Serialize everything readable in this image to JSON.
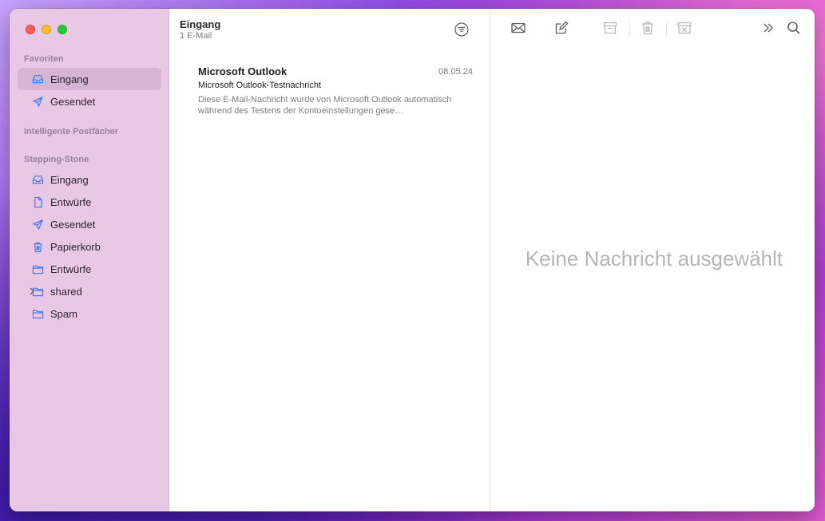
{
  "sidebar": {
    "favorites_title": "Favoriten",
    "favorites": [
      {
        "label": "Eingang",
        "icon": "inbox-icon",
        "selected": true
      },
      {
        "label": "Gesendet",
        "icon": "paperplane-icon"
      }
    ],
    "smart_title": "Intelligente Postfächer",
    "account_title": "Stepping-Stone",
    "account_items": [
      {
        "label": "Eingang",
        "icon": "inbox-icon"
      },
      {
        "label": "Entwürfe",
        "icon": "document-icon"
      },
      {
        "label": "Gesendet",
        "icon": "paperplane-icon"
      },
      {
        "label": "Papierkorb",
        "icon": "trash-icon"
      },
      {
        "label": "Entwürfe",
        "icon": "folder-icon"
      },
      {
        "label": "shared",
        "icon": "folder-icon",
        "collapsed": true
      },
      {
        "label": "Spam",
        "icon": "folder-icon"
      }
    ]
  },
  "list": {
    "title": "Eingang",
    "count": "1 E-Mail",
    "messages": [
      {
        "sender": "Microsoft Outlook",
        "date": "08.05.24",
        "subject": "Microsoft Outlook-Testnachricht",
        "preview": "Diese E-Mail-Nachricht wurde von Microsoft Outlook automatisch während des Testens der Kontoeinstellungen gese…"
      }
    ]
  },
  "reader": {
    "empty_text": "Keine Nachricht ausgewählt",
    "toolbar": [
      "get-mail-icon",
      "compose-icon",
      "archive-icon",
      "trash-icon",
      "junk-icon",
      "more-icon",
      "search-icon"
    ]
  },
  "colors": {
    "accent": "#3478f6",
    "sidebar_bg": "#e9c8e6",
    "sidebar_selected": "#d8b4d4"
  }
}
